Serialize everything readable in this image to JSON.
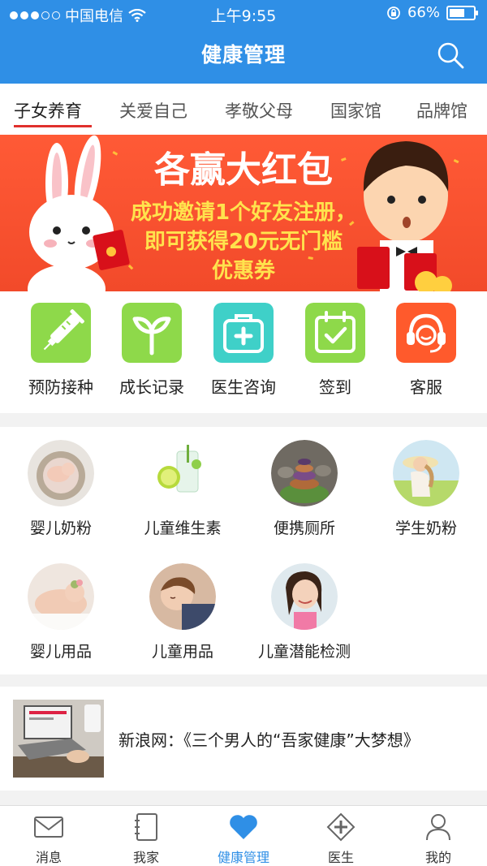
{
  "status_bar": {
    "carrier": "中国电信",
    "time": "上午9:55",
    "battery": "66%"
  },
  "nav": {
    "title": "健康管理"
  },
  "tabs": [
    {
      "label": "子女养育",
      "active": true
    },
    {
      "label": "关爱自己",
      "active": false
    },
    {
      "label": "孝敬父母",
      "active": false
    },
    {
      "label": "国家馆",
      "active": false
    },
    {
      "label": "品牌馆",
      "active": false
    }
  ],
  "banner": {
    "title": "各赢大红包",
    "line1": "成功邀请1个好友注册，",
    "line2": "即可获得20元无门槛",
    "line3": "优惠券"
  },
  "quick_actions": [
    {
      "label": "预防接种",
      "icon": "syringe-icon",
      "color": "#8ed94a"
    },
    {
      "label": "成长记录",
      "icon": "sprout-icon",
      "color": "#8ed94a"
    },
    {
      "label": "医生咨询",
      "icon": "medical-kit-icon",
      "color": "#3fd0c8"
    },
    {
      "label": "签到",
      "icon": "calendar-check-icon",
      "color": "#8ed94a"
    },
    {
      "label": "客服",
      "icon": "headset-icon",
      "color": "#ff5a2c"
    }
  ],
  "categories": [
    {
      "label": "婴儿奶粉",
      "icon": "baby-sleeping-nest-photo"
    },
    {
      "label": "儿童维生素",
      "icon": "lime-drink-photo"
    },
    {
      "label": "便携厕所",
      "icon": "stacked-stones-photo"
    },
    {
      "label": "学生奶粉",
      "icon": "girl-in-hat-photo"
    },
    {
      "label": "婴儿用品",
      "icon": "sleeping-baby-photo"
    },
    {
      "label": "儿童用品",
      "icon": "sleeping-child-photo"
    },
    {
      "label": "儿童潜能检测",
      "icon": "smiling-girl-photo"
    }
  ],
  "news": {
    "title": "新浪网：《三个男人的“吾家健康”大梦想》"
  },
  "bottom_nav": [
    {
      "label": "消息",
      "icon": "envelope-icon",
      "active": false
    },
    {
      "label": "我家",
      "icon": "notebook-icon",
      "active": false
    },
    {
      "label": "健康管理",
      "icon": "heart-icon",
      "active": true
    },
    {
      "label": "医生",
      "icon": "medical-cross-icon",
      "active": false
    },
    {
      "label": "我的",
      "icon": "person-icon",
      "active": false
    }
  ],
  "colors": {
    "brand_blue": "#2f8fe6",
    "tab_underline": "#e0302c",
    "banner_red": "#f24a2a",
    "banner_text_yellow": "#ffe34d"
  }
}
